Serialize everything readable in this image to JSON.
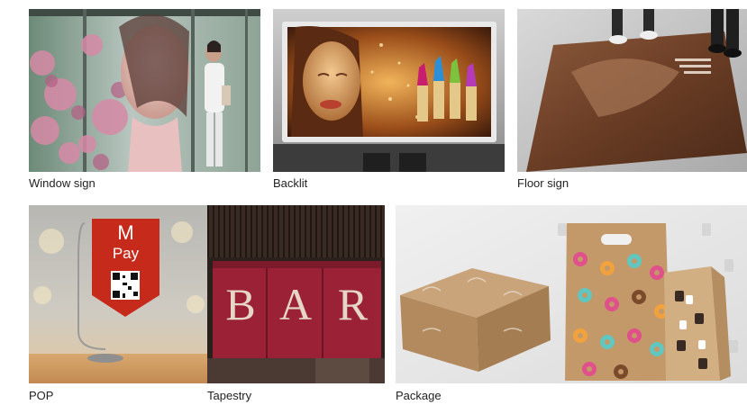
{
  "gallery": {
    "items": [
      {
        "label": "Window sign"
      },
      {
        "label": "Backlit"
      },
      {
        "label": "Floor sign"
      },
      {
        "label": "POP"
      },
      {
        "label": "Tapestry"
      },
      {
        "label": "Package"
      }
    ],
    "pop_sign": {
      "letter": "M",
      "word": "Pay"
    },
    "tapestry_letters": [
      "B",
      "A",
      "R"
    ]
  }
}
